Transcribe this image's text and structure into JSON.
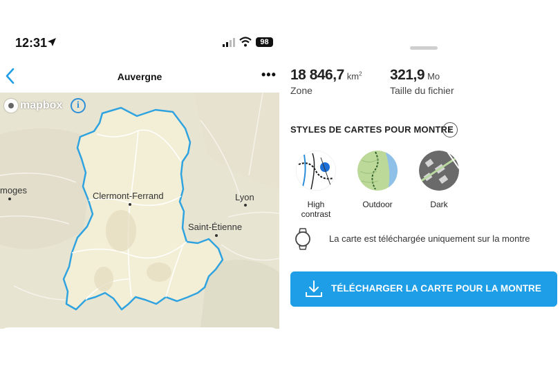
{
  "status_bar": {
    "time": "12:31",
    "battery": "98"
  },
  "nav": {
    "title": "Auvergne",
    "more": "•••"
  },
  "map": {
    "attribution": "mapbox",
    "info": "i",
    "cities": [
      "moges",
      "Clermont-Ferrand",
      "Lyon",
      "Saint-Étienne"
    ]
  },
  "stats": {
    "area_value": "18 846,7",
    "area_unit": "km",
    "area_unit_sup": "2",
    "area_label": "Zone",
    "size_value": "321,9",
    "size_unit": "Mo",
    "size_label": "Taille du fichier"
  },
  "styles_section": {
    "title": "STYLES DE CARTES POUR MONTRE",
    "info": "i",
    "options": [
      {
        "label_line1": "High",
        "label_line2": "contrast"
      },
      {
        "label_line1": "Outdoor"
      },
      {
        "label_line1": "Dark"
      }
    ]
  },
  "note": "La carte est téléchargée uniquement sur la montre",
  "download_button": {
    "label": "TÉLÉCHARGER LA CARTE POUR LA MONTRE"
  },
  "colors": {
    "accent": "#1e9ee6",
    "region_border": "#2fa3e0",
    "map_bg": "#e8e4d2"
  },
  "icons": [
    "location-arrow-icon",
    "signal-icon",
    "wifi-icon",
    "chevron-left-icon",
    "info-icon",
    "watch-icon",
    "download-icon"
  ]
}
